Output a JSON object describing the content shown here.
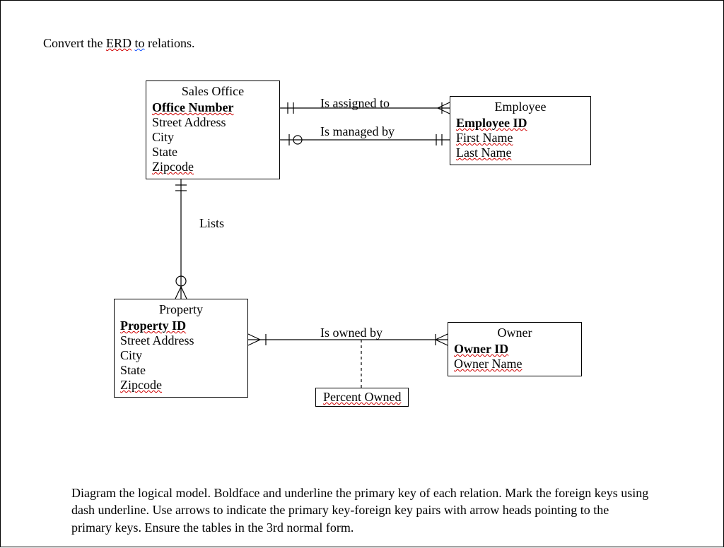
{
  "instruction_prefix": "Convert the ",
  "instruction_mid": "ERD",
  "instruction_sep": " ",
  "instruction_mid2": "to",
  "instruction_suffix": " relations.",
  "entities": {
    "sales_office": {
      "title": "Sales Office",
      "pk": "Office  Number",
      "attrs": [
        "Street Address",
        "City",
        "State"
      ],
      "wavy_attr": "Zipcode"
    },
    "property": {
      "title": "Property",
      "pk": "Property  ID",
      "attrs": [
        "Street Address",
        "City",
        "State"
      ],
      "wavy_attr": "Zipcode"
    },
    "employee": {
      "title": "Employee",
      "pk": "Employee  ID",
      "wavy_attrs": [
        "First  Name",
        "Last  Name"
      ]
    },
    "owner": {
      "title": "Owner",
      "pk": "Owner  ID",
      "wavy_attr": "Owner  Name"
    }
  },
  "relationships": {
    "assigned": "Is assigned to",
    "managed": "Is managed by",
    "lists": "Lists",
    "owned": "Is owned by"
  },
  "assoc_attr": "Percent  Owned",
  "paragraph_lead": "Diagram",
  "paragraph": " the logical model. Boldface and underline the primary key of each relation. Mark the foreign keys using dash underline. Use arrows to indicate the primary key-foreign key pairs with arrow heads pointing to the primary keys. Ensure the tables in the 3rd normal form.",
  "chart_data": {
    "type": "diagram",
    "notation": "Crow's foot ERD",
    "entities": [
      {
        "name": "Sales Office",
        "pk": "Office Number",
        "attributes": [
          "Street Address",
          "City",
          "State",
          "Zipcode"
        ]
      },
      {
        "name": "Employee",
        "pk": "Employee ID",
        "attributes": [
          "First Name",
          "Last Name"
        ]
      },
      {
        "name": "Property",
        "pk": "Property ID",
        "attributes": [
          "Street Address",
          "City",
          "State",
          "Zipcode"
        ]
      },
      {
        "name": "Owner",
        "pk": "Owner ID",
        "attributes": [
          "Owner Name"
        ]
      }
    ],
    "relationships": [
      {
        "name": "Is assigned to",
        "from": "Sales Office",
        "to": "Employee",
        "from_card": "one-mandatory",
        "to_card": "many-mandatory"
      },
      {
        "name": "Is managed by",
        "from": "Sales Office",
        "to": "Employee",
        "from_card": "one-optional",
        "to_card": "one-mandatory"
      },
      {
        "name": "Lists",
        "from": "Sales Office",
        "to": "Property",
        "from_card": "one-mandatory",
        "to_card": "many-optional"
      },
      {
        "name": "Is owned by",
        "from": "Property",
        "to": "Owner",
        "from_card": "many-mandatory",
        "to_card": "many-mandatory",
        "attributes": [
          "Percent Owned"
        ]
      }
    ]
  }
}
